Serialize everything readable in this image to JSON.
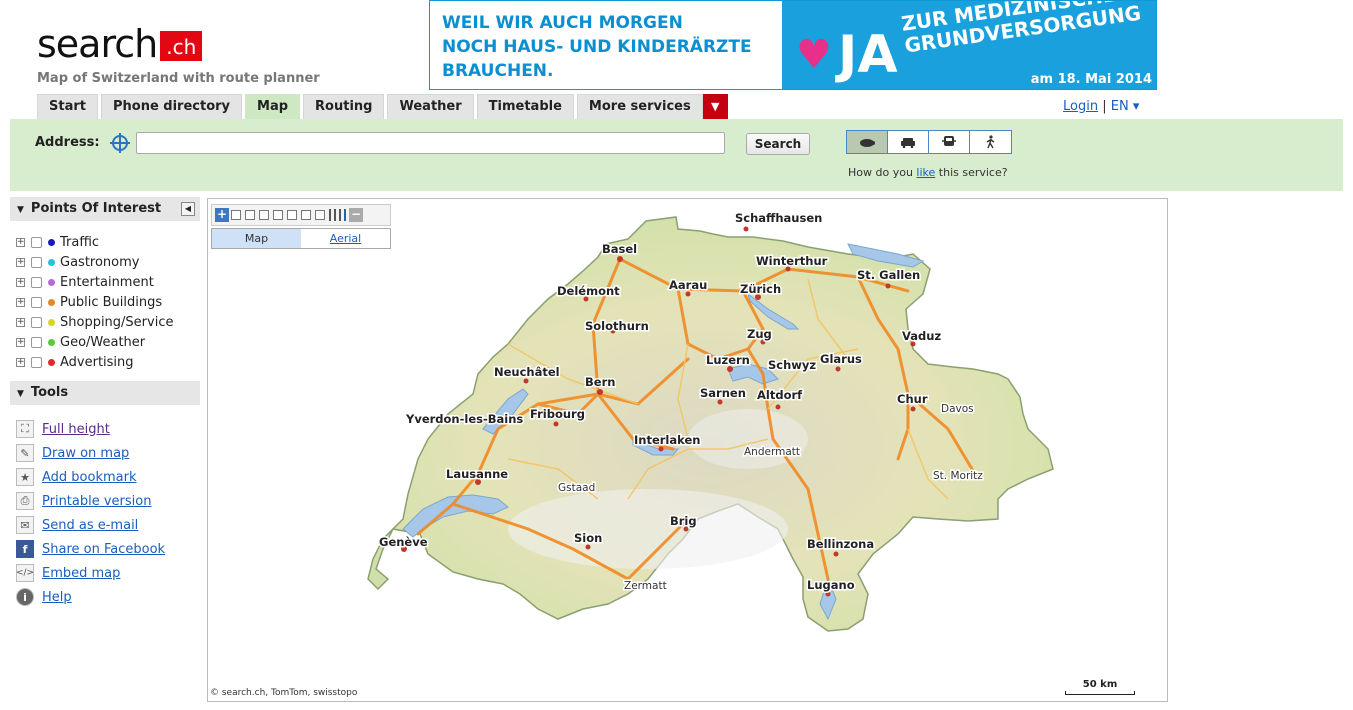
{
  "header": {
    "logo_main": "search",
    "logo_suffix": ".ch",
    "tagline": "Map of Switzerland with route planner"
  },
  "banner": {
    "left_line1": "WEIL WIR AUCH MORGEN",
    "left_line2": "NOCH HAUS- UND KINDERÄRZTE",
    "left_line3": "BRAUCHEN.",
    "ja": "JA",
    "right_line1": "ZUR MEDIZINISCHEN",
    "right_line2": "GRUNDVERSORGUNG",
    "date": "am 18. Mai 2014"
  },
  "tabs": [
    {
      "label": "Start"
    },
    {
      "label": "Phone directory"
    },
    {
      "label": "Map"
    },
    {
      "label": "Routing"
    },
    {
      "label": "Weather"
    },
    {
      "label": "Timetable"
    },
    {
      "label": "More services"
    }
  ],
  "toplinks": {
    "login": "Login",
    "separator": "|",
    "lang": "EN ▾"
  },
  "search": {
    "address_label": "Address:",
    "address_value": "",
    "button": "Search",
    "feedback_before": "How do you ",
    "feedback_link": "like",
    "feedback_after": " this service?"
  },
  "poi": {
    "title": "Points Of Interest",
    "items": [
      {
        "label": "Traffic",
        "color": "#1a1ab8"
      },
      {
        "label": "Gastronomy",
        "color": "#25c3d6"
      },
      {
        "label": "Entertainment",
        "color": "#b36ad6"
      },
      {
        "label": "Public Buildings",
        "color": "#e08a2a"
      },
      {
        "label": "Shopping/Service",
        "color": "#d6d62a"
      },
      {
        "label": "Geo/Weather",
        "color": "#5ac83a"
      },
      {
        "label": "Advertising",
        "color": "#e02a2a"
      }
    ]
  },
  "tools": {
    "title": "Tools",
    "items": [
      {
        "label": "Full height",
        "icon": "fullscreen-icon"
      },
      {
        "label": "Draw on map",
        "icon": "pencil-icon"
      },
      {
        "label": "Add bookmark",
        "icon": "star-icon"
      },
      {
        "label": "Printable version",
        "icon": "printer-icon"
      },
      {
        "label": "Send as e-mail",
        "icon": "envelope-icon"
      },
      {
        "label": "Share on Facebook",
        "icon": "facebook-icon"
      },
      {
        "label": "Embed map",
        "icon": "code-icon"
      },
      {
        "label": "Help",
        "icon": "info-icon"
      }
    ]
  },
  "map": {
    "type_map": "Map",
    "type_aerial": "Aerial",
    "copyright": "© search.ch, TomTom, swisstopo",
    "scale": "50 km",
    "cities": {
      "schaffhausen": "Schaffhausen",
      "basel": "Basel",
      "winterthur": "Winterthur",
      "stgallen": "St. Gallen",
      "delemont": "Delémont",
      "aarau": "Aarau",
      "zurich": "Zürich",
      "solothurn": "Solothurn",
      "zug": "Zug",
      "vaduz": "Vaduz",
      "neuchatel": "Neuchâtel",
      "luzern": "Luzern",
      "schwyz": "Schwyz",
      "glarus": "Glarus",
      "bern": "Bern",
      "sarnen": "Sarnen",
      "altdorf": "Altdorf",
      "chur": "Chur",
      "davos": "Davos",
      "yverdon": "Yverdon-les-Bains",
      "fribourg": "Fribourg",
      "interlaken": "Interlaken",
      "andermatt": "Andermatt",
      "lausanne": "Lausanne",
      "stmoritz": "St. Moritz",
      "gstaad": "Gstaad",
      "brig": "Brig",
      "geneve": "Genève",
      "sion": "Sion",
      "bellinzona": "Bellinzona",
      "zermatt": "Zermatt",
      "lugano": "Lugano"
    }
  }
}
